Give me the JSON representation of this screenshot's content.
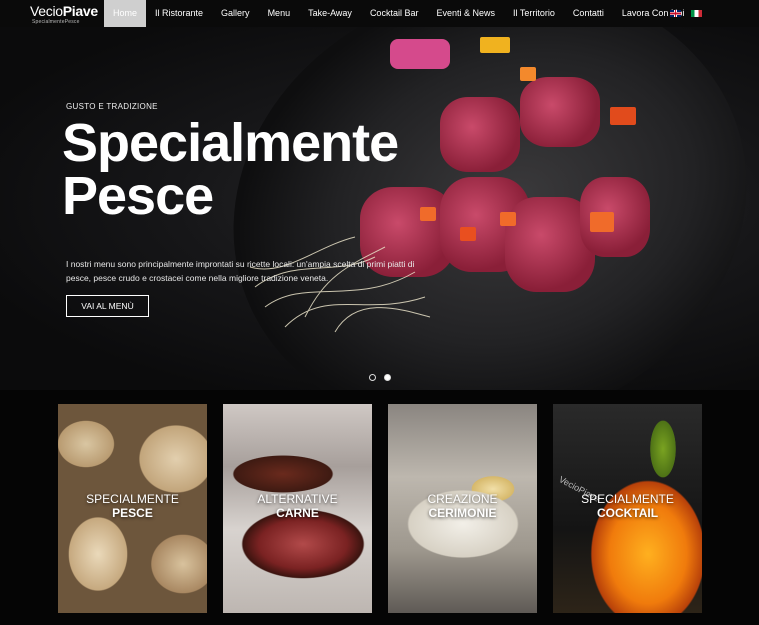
{
  "brand": {
    "logo_main": "VecioPiave",
    "logo_prefix": "Vecio",
    "logo_suffix": "Piave",
    "logo_sub": "SpecialmentePesce"
  },
  "nav": {
    "items": [
      {
        "label": "Home",
        "active": true
      },
      {
        "label": "Il Ristorante"
      },
      {
        "label": "Gallery"
      },
      {
        "label": "Menu"
      },
      {
        "label": "Take-Away"
      },
      {
        "label": "Cocktail Bar"
      },
      {
        "label": "Eventi & News"
      },
      {
        "label": "Il Territorio"
      },
      {
        "label": "Contatti"
      },
      {
        "label": "Lavora Con Noi"
      }
    ],
    "languages": [
      "english-flag-icon",
      "italian-flag-icon"
    ]
  },
  "hero": {
    "eyebrow": "GUSTO E TRADIZIONE",
    "title_line1": "Specialmente",
    "title_line2": "Pesce",
    "text": "I nostri menu sono principalmente improntati su ricette locali: un'ampia scelta di primi piatti di pesce, pesce crudo e crostacei come nella migliore tradizione veneta.",
    "button": "VAI AL MENÙ",
    "slides": 2,
    "active_slide": 2
  },
  "cards": [
    {
      "line1": "SPECIALMENTE",
      "line2": "PESCE"
    },
    {
      "line1": "ALTERNATIVE",
      "line2": "CARNE"
    },
    {
      "line1": "CREAZIONE",
      "line2": "CERIMONIE"
    },
    {
      "line1": "SPECIALMENTE",
      "line2": "COCKTAIL"
    }
  ],
  "colors": {
    "nav_bg": "#0a0a0a",
    "active_tab": "#cfcfcf",
    "page_bg": "#050505"
  }
}
